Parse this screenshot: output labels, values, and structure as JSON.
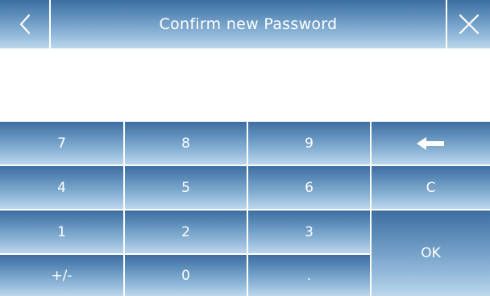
{
  "header": {
    "title": "Confirm new Password",
    "back_icon": "chevron-left-icon",
    "close_icon": "close-icon"
  },
  "display": {
    "value": ""
  },
  "keypad": {
    "keys": {
      "k7": "7",
      "k8": "8",
      "k9": "9",
      "backspace_icon": "backspace-arrow-icon",
      "k4": "4",
      "k5": "5",
      "k6": "6",
      "clear": "C",
      "k1": "1",
      "k2": "2",
      "k3": "3",
      "ok": "OK",
      "sign": "+/-",
      "k0": "0",
      "decimal": "."
    }
  },
  "colors": {
    "button_top": "#3d6ea0",
    "button_bottom": "#bdd7ec",
    "text": "#ffffff",
    "background": "#ffffff"
  }
}
